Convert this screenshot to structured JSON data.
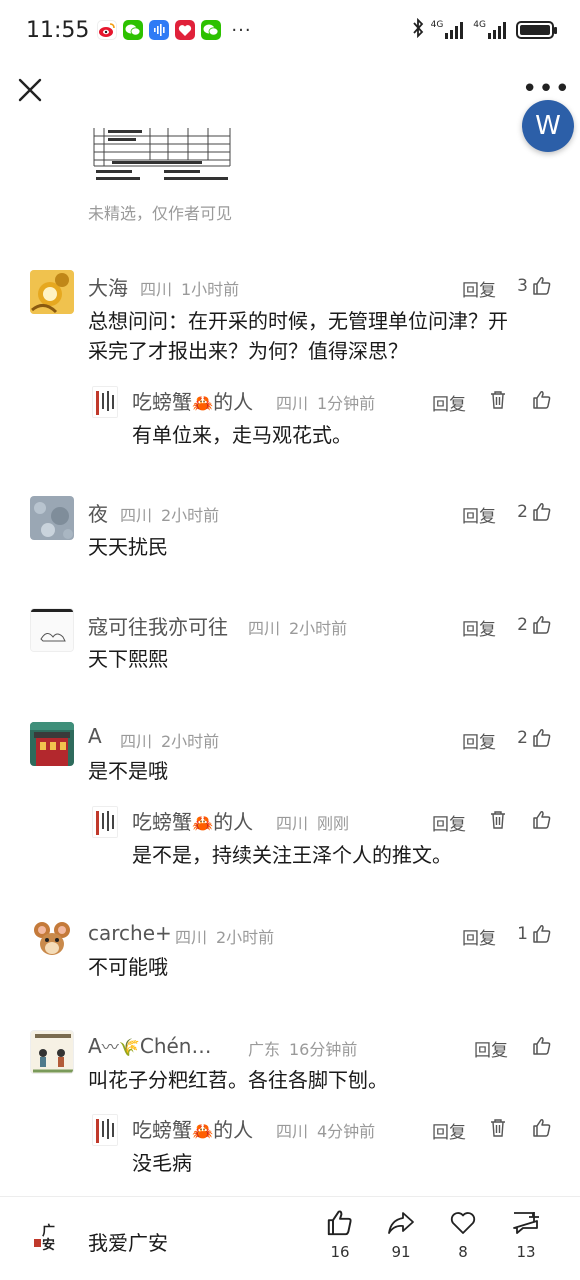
{
  "status_bar": {
    "time": "11:55",
    "more": "···",
    "signal_1": "4G",
    "signal_2": "4G"
  },
  "header": {
    "more": "•••",
    "avatar_letter": "W"
  },
  "post": {
    "note": "未精选，仅作者可见"
  },
  "comments": [
    {
      "name": "大海",
      "location": "四川",
      "time": "1小时前",
      "reply": "回复",
      "likes": "3",
      "text_line1": "总想问问：在开采的时候，无管理单位问津？开",
      "text_line2": "采完了才报出来？为何？值得深思？",
      "replies": [
        {
          "name": "吃螃蟹",
          "name_suffix": "的人",
          "location": "四川",
          "time": "1分钟前",
          "reply": "回复",
          "text": "有单位来，走马观花式。"
        }
      ]
    },
    {
      "name": "夜",
      "location": "四川",
      "time": "2小时前",
      "reply": "回复",
      "likes": "2",
      "text": "天天扰民"
    },
    {
      "name": "寇可往我亦可往",
      "location": "四川",
      "time": "2小时前",
      "reply": "回复",
      "likes": "2",
      "text": "天下熙熙"
    },
    {
      "name": "A",
      "location": "四川",
      "time": "2小时前",
      "reply": "回复",
      "likes": "2",
      "text": "是不是哦",
      "replies": [
        {
          "name": "吃螃蟹",
          "name_suffix": "的人",
          "location": "四川",
          "time": "刚刚",
          "reply": "回复",
          "text": "是不是，持续关注王泽个人的推文。"
        }
      ]
    },
    {
      "name": "carche+",
      "location": "四川",
      "time": "2小时前",
      "reply": "回复",
      "likes": "1",
      "text": "不可能哦"
    },
    {
      "name": "A",
      "name_suffix": "Chén…",
      "location": "广东",
      "time": "16分钟前",
      "reply": "回复",
      "text": "叫花子分粑红苕。各往各脚下刨。",
      "replies": [
        {
          "name": "吃螃蟹",
          "name_suffix": "的人",
          "location": "四川",
          "time": "4分钟前",
          "reply": "回复",
          "text": "没毛病"
        }
      ]
    }
  ],
  "bottom_bar": {
    "brand_name": "我爱广安",
    "logo_text": "广安",
    "likes": "16",
    "shares": "91",
    "favorites": "8",
    "comments": "13"
  },
  "colors": {
    "accent_blue": "#2c5fa8",
    "text_gray": "#9a9a9a",
    "crab_red": "#d9412b"
  },
  "icons": [
    "close-icon",
    "more-icon",
    "thumbs-up-icon",
    "delete-icon",
    "share-icon",
    "heart-icon",
    "comment-add-icon",
    "crab-icon"
  ]
}
